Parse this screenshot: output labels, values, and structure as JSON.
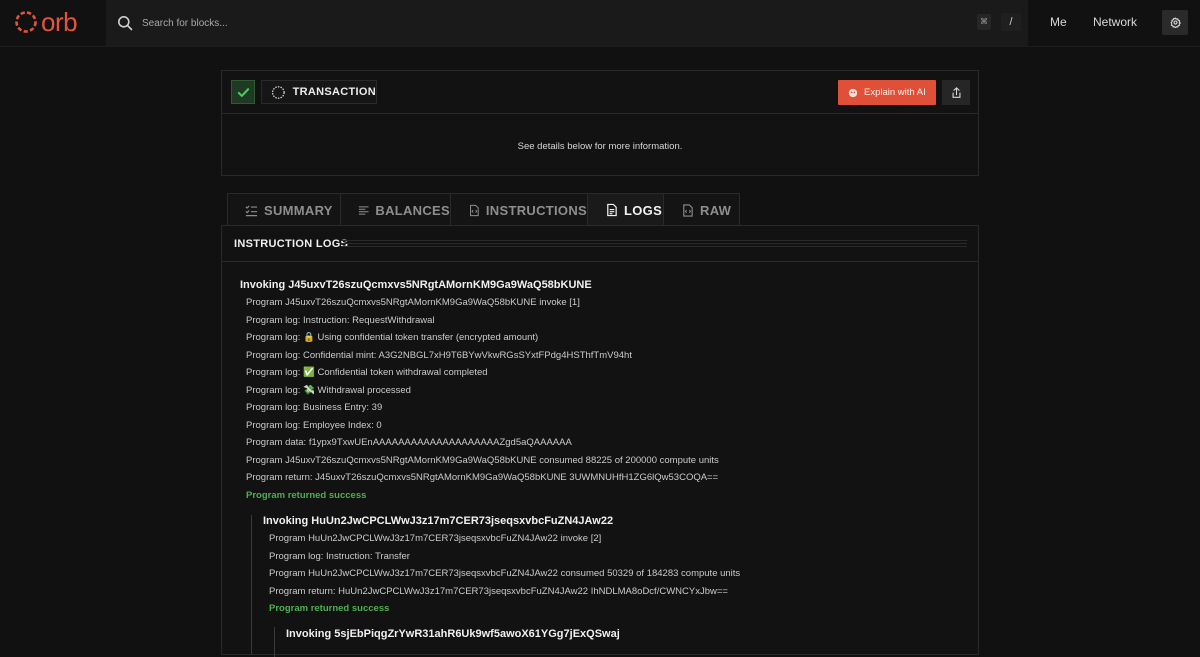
{
  "header": {
    "logo_text": "orb",
    "search_placeholder": "Search for blocks...",
    "shortcut_icon": "⌘",
    "shortcut_key": "/",
    "nav": {
      "me": "Me",
      "network": "Network"
    }
  },
  "transaction": {
    "status": "success",
    "type_label": "TRANSACTION",
    "explain_label": "Explain with AI",
    "details_text": "See details below for more information."
  },
  "tabs": [
    {
      "label": "SUMMARY",
      "icon": "checklist-icon"
    },
    {
      "label": "BALANCES",
      "icon": "lines-icon"
    },
    {
      "label": "INSTRUCTIONS",
      "icon": "code-file-icon"
    },
    {
      "label": "LOGS",
      "icon": "document-icon",
      "active": true
    },
    {
      "label": "RAW",
      "icon": "code-file-icon"
    }
  ],
  "logs": {
    "title": "INSTRUCTION LOGS",
    "invocations": [
      {
        "title": "Invoking J45uxvT26szuQcmxvs5NRgtAMornKM9Ga9WaQ58bKUNE",
        "lines": [
          "Program J45uxvT26szuQcmxvs5NRgtAMornKM9Ga9WaQ58bKUNE invoke [1]",
          "Program log: Instruction: RequestWithdrawal",
          "Program log: 🔒 Using confidential token transfer (encrypted amount)",
          "Program log: Confidential mint: A3G2NBGL7xH9T6BYwVkwRGsSYxtFPdg4HSThfTmV94ht",
          "Program log: ✅ Confidential token withdrawal completed",
          "Program log: 💸 Withdrawal processed",
          "Program log: Business Entry: 39",
          "Program log: Employee Index: 0",
          "Program data: f1ypx9TxwUEnAAAAAAAAAAAAAAAAAAAAZgd5aQAAAAAA",
          "Program J45uxvT26szuQcmxvs5NRgtAMornKM9Ga9WaQ58bKUNE consumed 88225 of 200000 compute units",
          "Program return: J45uxvT26szuQcmxvs5NRgtAMornKM9Ga9WaQ58bKUNE 3UWMNUHfH1ZG6lQw53COQA=="
        ],
        "result": "Program returned success"
      },
      {
        "title": "Invoking HuUn2JwCPCLWwJ3z17m7CER73jseqsxvbcFuZN4JAw22",
        "lines": [
          "Program HuUn2JwCPCLWwJ3z17m7CER73jseqsxvbcFuZN4JAw22 invoke [2]",
          "Program log: Instruction: Transfer",
          "Program HuUn2JwCPCLWwJ3z17m7CER73jseqsxvbcFuZN4JAw22 consumed 50329 of 184283 compute units",
          "Program return: HuUn2JwCPCLWwJ3z17m7CER73jseqsxvbcFuZN4JAw22 IhNDLMA8oDcf/CWNCYxJbw=="
        ],
        "result": "Program returned success"
      },
      {
        "title": "Invoking 5sjEbPiqgZrYwR31ahR6Uk9wf5awoX61YGg7jExQSwaj",
        "lines": [],
        "result": ""
      }
    ]
  },
  "colors": {
    "accent": "#e05038",
    "success": "#4caf50",
    "background": "#111111"
  }
}
